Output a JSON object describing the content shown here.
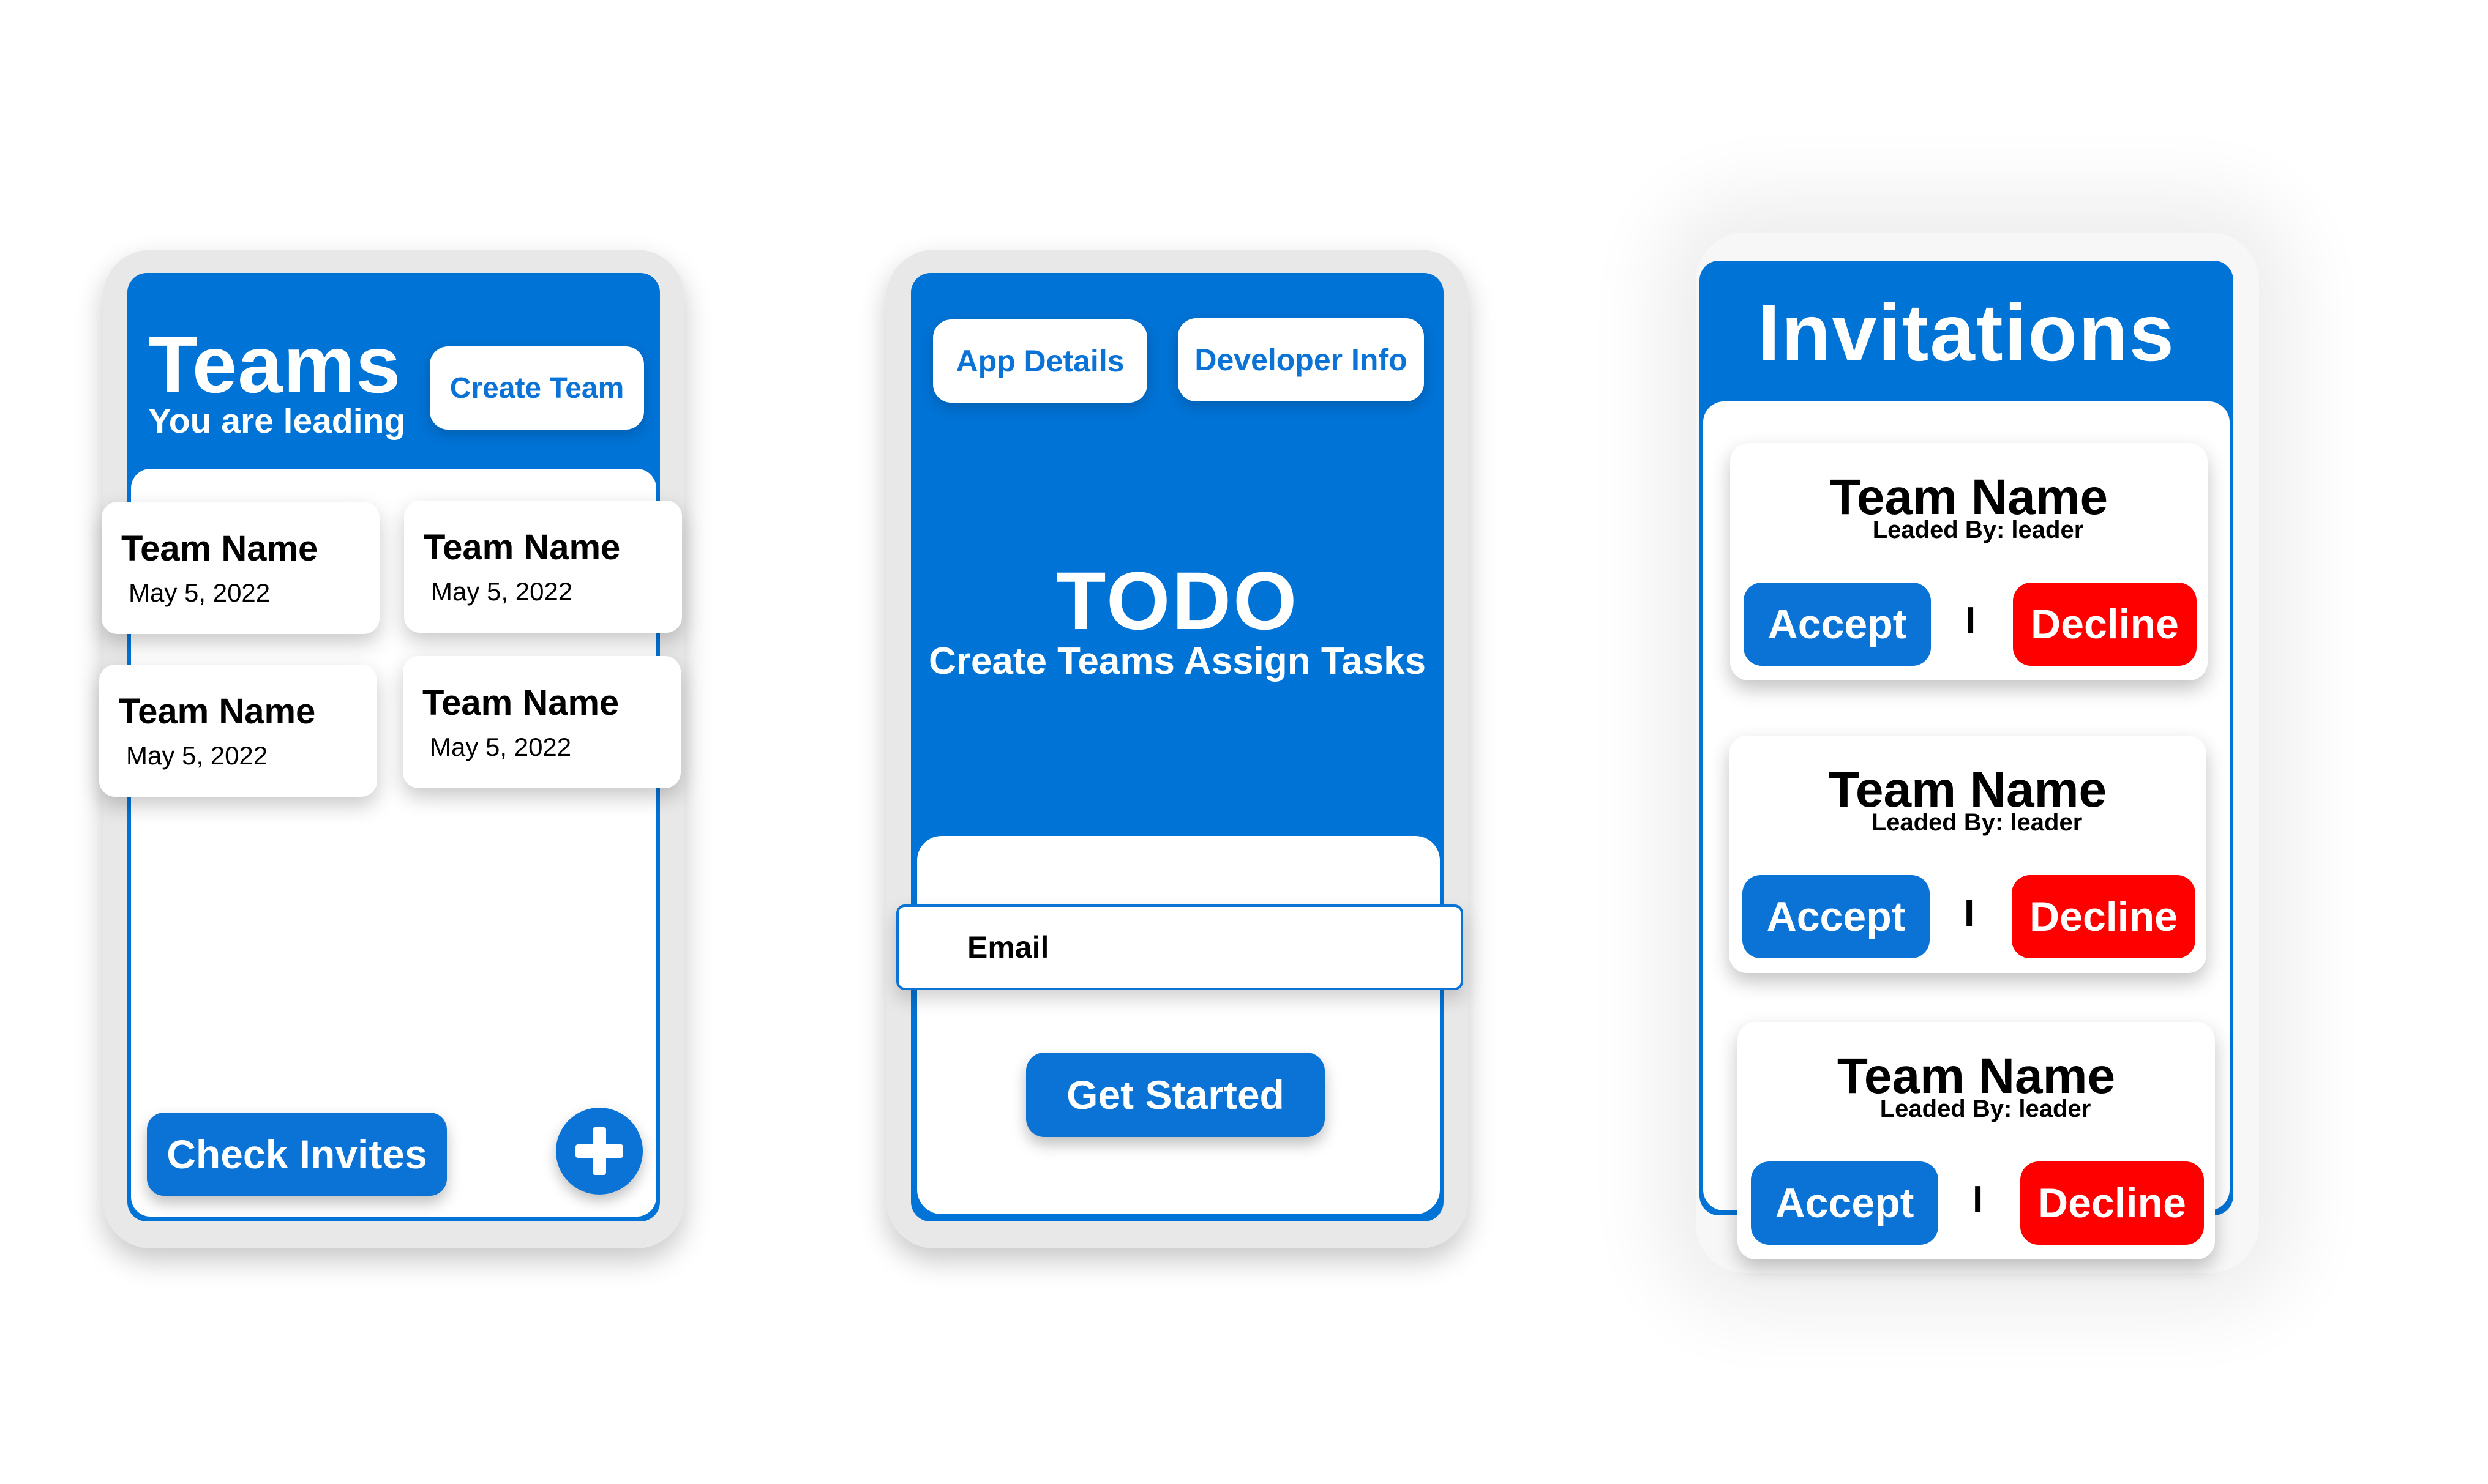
{
  "colors": {
    "primary_blue": "#0073d6",
    "button_blue": "#0b73d5",
    "decline_red": "#ff0000",
    "frame_gray": "#e9e8e8"
  },
  "teams_screen": {
    "title": "Teams",
    "subtitle": "You are leading",
    "create_team_label": "Create Team",
    "teams": [
      {
        "name": "Team Name",
        "date": "May 5, 2022"
      },
      {
        "name": "Team Name",
        "date": "May 5, 2022"
      },
      {
        "name": "Team Name",
        "date": "May 5, 2022"
      },
      {
        "name": "Team Name",
        "date": "May 5, 2022"
      }
    ],
    "check_invites_label": "Check Invites",
    "add_icon": "plus-icon"
  },
  "welcome_screen": {
    "app_details_label": "App Details",
    "developer_info_label": "Developer Info",
    "app_title": "TODO",
    "tagline": "Create Teams Assign Tasks",
    "email_placeholder": "Email",
    "get_started_label": "Get Started"
  },
  "invitations_screen": {
    "title": "Invitations",
    "separator": "I",
    "invites": [
      {
        "team_name": "Team Name",
        "leader_text": "Leaded By: leader",
        "accept_label": "Accept",
        "decline_label": "Decline"
      },
      {
        "team_name": "Team Name",
        "leader_text": "Leaded By: leader",
        "accept_label": "Accept",
        "decline_label": "Decline"
      },
      {
        "team_name": "Team Name",
        "leader_text": "Leaded By: leader",
        "accept_label": "Accept",
        "decline_label": "Decline"
      }
    ]
  }
}
